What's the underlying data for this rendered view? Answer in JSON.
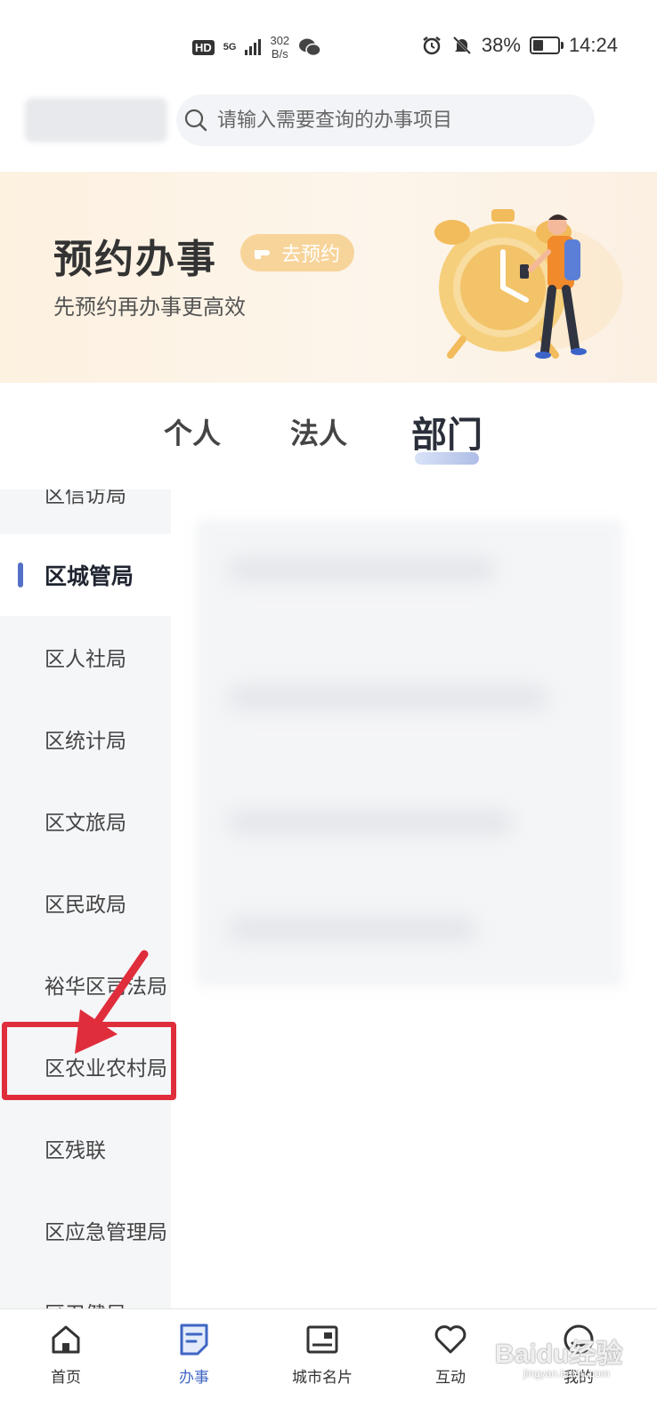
{
  "status_bar": {
    "hd": "HD",
    "signal": "5G",
    "speed_top": "302",
    "speed_unit": "B/s",
    "battery": "38%",
    "time": "14:24"
  },
  "search": {
    "placeholder": "请输入需要查询的办事项目"
  },
  "banner": {
    "title": "预约办事",
    "button": "去预约",
    "subtitle": "先预约再办事更高效"
  },
  "tabs": [
    {
      "label": "个人"
    },
    {
      "label": "法人"
    },
    {
      "label": "部门",
      "active": true
    }
  ],
  "sidebar": {
    "items": [
      {
        "label": "区信访局"
      },
      {
        "label": "区城管局",
        "active": true
      },
      {
        "label": "区人社局"
      },
      {
        "label": "区统计局"
      },
      {
        "label": "区文旅局"
      },
      {
        "label": "区民政局"
      },
      {
        "label": "裕华区司法局"
      },
      {
        "label": "区农业农村局",
        "highlighted": true
      },
      {
        "label": "区残联"
      },
      {
        "label": "区应急管理局"
      },
      {
        "label": "区卫健局"
      }
    ]
  },
  "tabbar": {
    "items": [
      {
        "label": "首页",
        "icon": "home-icon"
      },
      {
        "label": "办事",
        "icon": "document-icon",
        "active": true
      },
      {
        "label": "城市名片",
        "icon": "city-card-icon"
      },
      {
        "label": "互动",
        "icon": "heart-icon"
      },
      {
        "label": "我的",
        "icon": "profile-icon"
      }
    ]
  },
  "watermark": {
    "text": "Baidu经验",
    "sub": "jingyan.baidu.com"
  },
  "colors": {
    "accent": "#3f66c4",
    "annotation": "#e02d3c",
    "banner_button": "#f7d49a"
  }
}
